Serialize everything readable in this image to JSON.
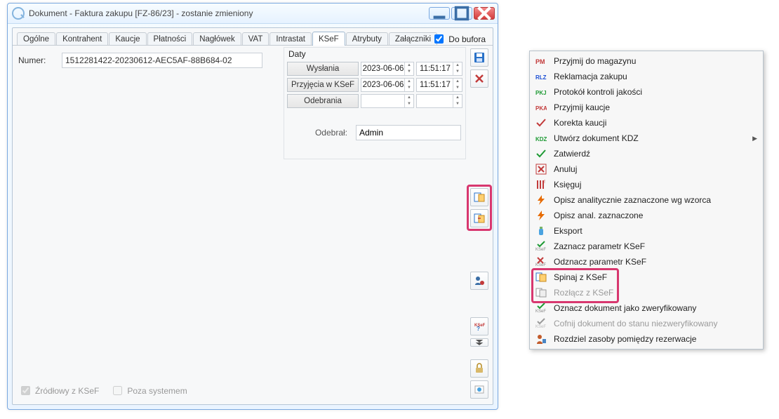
{
  "window": {
    "title": "Dokument - Faktura zakupu [FZ-86/23]  - zostanie zmieniony"
  },
  "tabs": [
    "Ogólne",
    "Kontrahent",
    "Kaucje",
    "Płatności",
    "Nagłówek",
    "VAT",
    "Intrastat",
    "KSeF",
    "Atrybuty",
    "Załączniki"
  ],
  "active_tab_index": 7,
  "do_bufora_label": "Do bufora",
  "do_bufora_checked": true,
  "numer_label": "Numer:",
  "numer_value": "1512281422-20230612-AEC5AF-88B684-02",
  "daty": {
    "title": "Daty",
    "rows": {
      "wyslania": {
        "label": "Wysłania",
        "date": "2023-06-06",
        "time": "11:51:17"
      },
      "przyjecia": {
        "label": "Przyjęcia w KSeF",
        "date": "2023-06-06",
        "time": "11:51:17"
      },
      "odebrania": {
        "label": "Odebrania",
        "date": "",
        "time": ""
      }
    },
    "odebral_label": "Odebrał:",
    "odebral_value": "Admin"
  },
  "bottom_checks": {
    "zrodlowy": {
      "label": "Źródłowy z KSeF",
      "checked": true
    },
    "poza": {
      "label": "Poza systemem",
      "checked": false
    }
  },
  "context_menu": [
    {
      "icon": "pm",
      "color": "#c23a3a",
      "label": "Przyjmij do magazynu"
    },
    {
      "icon": "rlz",
      "color": "#1b4ed4",
      "label": "Reklamacja zakupu"
    },
    {
      "icon": "pkj",
      "color": "#1e9a34",
      "label": "Protokół kontroli jakości"
    },
    {
      "icon": "pka",
      "color": "#c23a3a",
      "label": "Przyjmij kaucje"
    },
    {
      "icon": "check-red",
      "color": "#c23a3a",
      "label": "Korekta kaucji"
    },
    {
      "icon": "kdz",
      "color": "#1e9a34",
      "label": "Utwórz dokument KDZ",
      "submenu": true
    },
    {
      "icon": "check-green",
      "color": "#1e9a34",
      "label": "Zatwierdź"
    },
    {
      "icon": "x-red",
      "color": "#c23a3a",
      "label": "Anuluj"
    },
    {
      "icon": "bars",
      "color": "#c23a3a",
      "label": "Księguj"
    },
    {
      "icon": "bolt",
      "color": "#e66a00",
      "label": "Opisz analitycznie zaznaczone wg wzorca"
    },
    {
      "icon": "bolt",
      "color": "#e66a00",
      "label": "Opisz anal. zaznaczone"
    },
    {
      "icon": "bottle",
      "color": "#4aa3e0",
      "label": "Eksport"
    },
    {
      "icon": "ksef-check",
      "color": "#1e9a34",
      "label": "Zaznacz parametr KSeF"
    },
    {
      "icon": "ksef-x",
      "color": "#c23a3a",
      "label": "Odznacz parametr KSeF"
    },
    {
      "icon": "link-blue",
      "color": "#2a72c8",
      "label": "Spinaj z KSeF"
    },
    {
      "icon": "link-grey",
      "color": "#9a9a9a",
      "label": "Rozłącz z KSeF",
      "disabled": true
    },
    {
      "icon": "ksef-check",
      "color": "#1e9a34",
      "label": "Oznacz dokument jako zweryfikowany"
    },
    {
      "icon": "ksef-grey",
      "color": "#9a9a9a",
      "label": "Cofnij dokument do stanu niezweryfikowany",
      "disabled": true
    },
    {
      "icon": "person",
      "color": "#c25a2a",
      "label": "Rozdziel zasoby pomiędzy rezerwacje"
    }
  ],
  "highlighted_menu_indices": [
    14,
    15
  ]
}
